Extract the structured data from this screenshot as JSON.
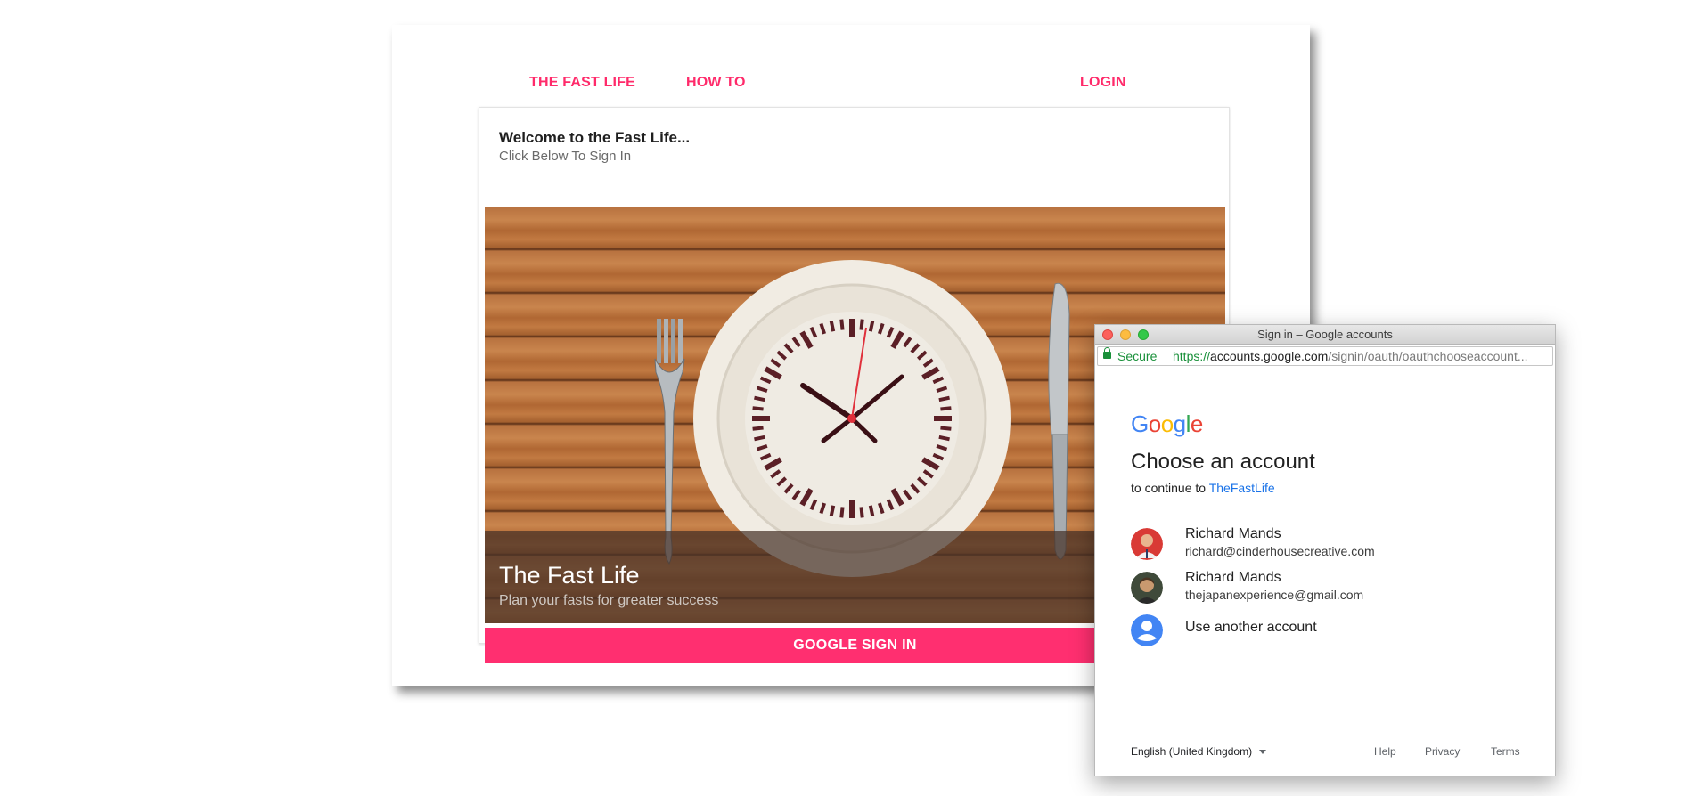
{
  "nav": {
    "brand": "THE FAST LIFE",
    "how_to": "HOW TO",
    "login": "LOGIN"
  },
  "card": {
    "title": "Welcome to the Fast Life...",
    "subtitle": "Click Below To Sign In",
    "media_title": "The Fast Life",
    "media_subtitle": "Plan your fasts for greater success",
    "signin_button": "GOOGLE SIGN IN"
  },
  "popup": {
    "window_title": "Sign in – Google accounts",
    "secure_label": "Secure",
    "url_scheme": "https://",
    "url_host": "accounts.google.com",
    "url_path": "/signin/oauth/oauthchooseaccount...",
    "logo": "Google",
    "heading": "Choose an account",
    "continue_prefix": "to continue to ",
    "app_name": "TheFastLife",
    "accounts": [
      {
        "name": "Richard Mands",
        "email": "richard@cinderhousecreative.com"
      },
      {
        "name": "Richard Mands",
        "email": "thejapanexperience@gmail.com"
      }
    ],
    "use_another": "Use another account",
    "language": "English (United Kingdom)",
    "footer": {
      "help": "Help",
      "privacy": "Privacy",
      "terms": "Terms"
    }
  },
  "colors": {
    "brand_pink": "#ff2f70",
    "google_blue": "#4285f4",
    "google_red": "#ea4335",
    "google_yellow": "#fbbc05",
    "google_green": "#34a853",
    "secure_green": "#19903a"
  },
  "icons": [
    "fork-icon",
    "knife-icon",
    "clock-plate-icon",
    "lock-icon",
    "person-icon",
    "chevron-down-icon"
  ]
}
